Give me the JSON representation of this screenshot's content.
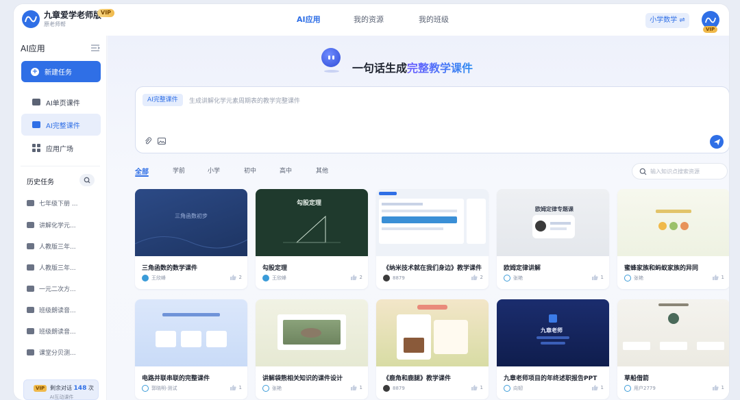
{
  "app": {
    "title": "九章爱学老师版",
    "subtitle": "原老师帮",
    "vip_label": "VIP"
  },
  "nav": {
    "tabs": [
      {
        "label": "AI应用",
        "active": true
      },
      {
        "label": "我的资源",
        "active": false
      },
      {
        "label": "我的班级",
        "active": false
      }
    ],
    "subject": "小学数学 ⇌",
    "avatar_vip": "VIP"
  },
  "sidebar": {
    "title": "AI应用",
    "new_task": "新建任务",
    "items": [
      {
        "label": "AI单页课件",
        "icon": "single-page-courseware-icon",
        "active": false
      },
      {
        "label": "AI完整课件",
        "icon": "full-courseware-icon",
        "active": true
      },
      {
        "label": "应用广场",
        "icon": "grid-apps-icon",
        "active": false
      }
    ],
    "history_title": "历史任务",
    "history": [
      "七年级下册 ...",
      "讲解化学元...",
      "人教版三年...",
      "人教版三年...",
      "一元二次方...",
      "班级朗读音...",
      "班级朗读音...",
      "课堂分贝测..."
    ],
    "quota": {
      "vip": "VIP",
      "text_prefix": "剩余对话",
      "count": "148",
      "text_suffix": "次",
      "sub": "AI互动课件"
    }
  },
  "hero": {
    "prefix": "一句话生成",
    "highlight": "完整教学课件"
  },
  "composer": {
    "mode_tag": "AI完整课件",
    "placeholder": "生成讲解化学元素周期表的教学完整课件"
  },
  "filters": [
    "全部",
    "学前",
    "小学",
    "初中",
    "高中",
    "其他"
  ],
  "search": {
    "placeholder": "输入知识点搜索资源"
  },
  "thumbs": {
    "c1": "三角函数初步",
    "c2": "勾股定理",
    "c4": "欧姆定律专题课",
    "c8": "九章老师"
  },
  "cards": [
    {
      "title": "三角函数的数学课件",
      "author": "王欣峰",
      "likes": "2"
    },
    {
      "title": "勾股定理",
      "author": "王欣峰",
      "likes": "2"
    },
    {
      "title": "《纳米技术就在我们身边》教学课件",
      "author": "8879",
      "likes": "2"
    },
    {
      "title": "欧姆定律讲解",
      "author": "张艳",
      "likes": "1"
    },
    {
      "title": "蜜蜂家族和蚂蚁家族的异同",
      "author": "张艳",
      "likes": "1"
    },
    {
      "title": "电路并联串联的完整课件",
      "author": "郭晓明-测试",
      "likes": "1"
    },
    {
      "title": "讲解袋熊相关知识的课件设计",
      "author": "张艳",
      "likes": "1"
    },
    {
      "title": "《鹿角和鹿腿》教学课件",
      "author": "8879",
      "likes": "1"
    },
    {
      "title": "九章老师项目的年终述职报告PPT",
      "author": "向韧",
      "likes": "1"
    },
    {
      "title": "草船借箭",
      "author": "用户2779",
      "likes": "1"
    }
  ]
}
